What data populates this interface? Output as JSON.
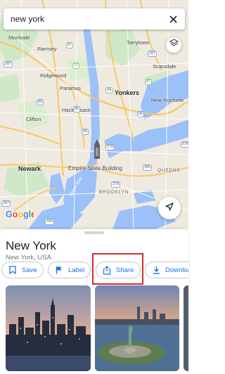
{
  "search": {
    "query": "new york",
    "close_icon": "close-icon"
  },
  "map": {
    "labels": {
      "montvale": "Montvale",
      "ramsey": "Ramsey",
      "tarrytown": "Tarrytown",
      "scarsdale": "Scarsdale",
      "ridgewood": "Ridgewood",
      "paramus": "Paramus",
      "yonkers": "Yonkers",
      "hackensack": "Hackensack",
      "new_rochelle": "New Rochelle",
      "clifton": "Clifton",
      "newark": "Newark",
      "empire_state_building": "Empire State Building",
      "queens": "QUEENS",
      "upper_bay": "Upper Bay",
      "brooklyn": "BROOKLYN",
      "google": "Google"
    },
    "shields": [
      "287",
      "87",
      "17",
      "287",
      "87",
      "95",
      "80",
      "9A",
      "278",
      "95",
      "495",
      "278",
      "678",
      "440",
      "80",
      "287"
    ],
    "icons": {
      "layers": "layers-icon",
      "locate": "navigation-arrow-icon"
    }
  },
  "sheet": {
    "title": "New York",
    "subtitle": "New York, USA",
    "actions": [
      {
        "label": "Save",
        "icon": "bookmark-icon"
      },
      {
        "label": "Label",
        "icon": "flag-icon"
      },
      {
        "label": "Share",
        "icon": "share-icon"
      },
      {
        "label": "Download",
        "icon": "download-icon"
      }
    ],
    "photos": [
      "manhattan-skyline-photo",
      "statue-of-liberty-photo"
    ]
  },
  "colors": {
    "accent": "#1a73e8",
    "highlight": "#d62b2b",
    "water": "#9cc0f9",
    "park": "#c9e7c3",
    "highway": "#f6c863"
  }
}
